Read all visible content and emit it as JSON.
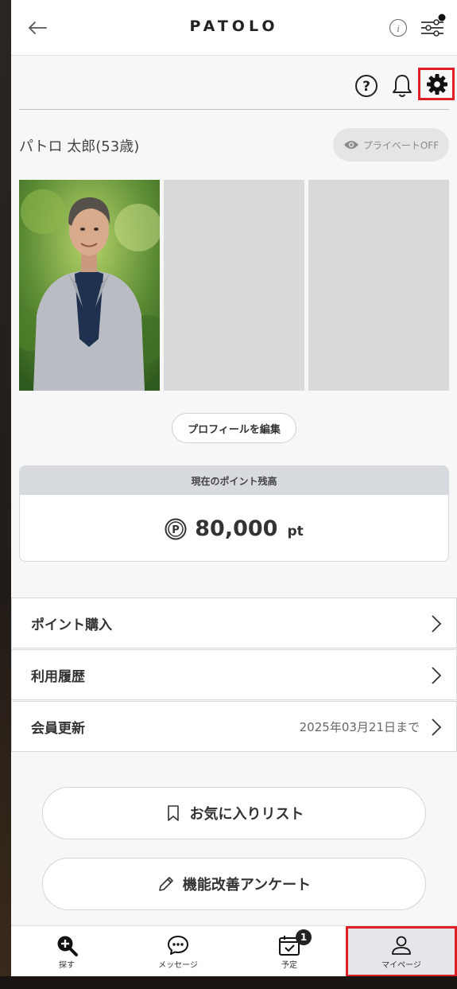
{
  "header": {
    "logo": "PATOLO",
    "back_icon": "arrow-left-icon",
    "info_icon": "info-icon",
    "filter_icon": "sliders-icon"
  },
  "toolbar": {
    "help_icon": "question-circle-icon",
    "bell_icon": "bell-icon",
    "settings_icon": "gear-icon",
    "highlight_color": "#e01e25"
  },
  "profile": {
    "name": "パトロ 太郎(53歳)",
    "private_toggle": "プライベートOFF",
    "edit_label": "プロフィールを編集"
  },
  "points": {
    "title": "現在のポイント残高",
    "value": "80,000",
    "unit": "pt"
  },
  "menu": {
    "items": [
      {
        "label": "ポイント購入",
        "sub": ""
      },
      {
        "label": "利用履歴",
        "sub": ""
      },
      {
        "label": "会員更新",
        "sub": "2025年03月21日まで"
      }
    ]
  },
  "actions": {
    "favorites": "お気に入りリスト",
    "survey": "機能改善アンケート"
  },
  "bottom_nav": {
    "items": [
      {
        "label": "探す",
        "icon": "search-plus-icon"
      },
      {
        "label": "メッセージ",
        "icon": "chat-icon"
      },
      {
        "label": "予定",
        "icon": "calendar-check-icon",
        "badge": "1"
      },
      {
        "label": "マイページ",
        "icon": "user-icon",
        "active": true
      }
    ]
  }
}
